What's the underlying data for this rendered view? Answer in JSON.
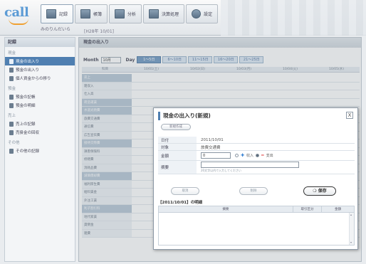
{
  "app": {
    "logo_text": "call",
    "user_name": "みのりんだいら",
    "date_line": "[H28年 10/01]"
  },
  "nav": [
    {
      "label": "記録",
      "icon": "notebook-icon"
    },
    {
      "label": "帳簿",
      "icon": "ledger-icon"
    },
    {
      "label": "分析",
      "icon": "chart-icon"
    },
    {
      "label": "決算処理",
      "icon": "calculator-icon"
    },
    {
      "label": "設定",
      "icon": "gear-icon"
    }
  ],
  "sidebar": {
    "title": "記録",
    "section1": "現金",
    "items1": [
      "現金の出入り",
      "預金の出入り",
      "個人資金からの移り"
    ],
    "section2": "預金",
    "items2": [
      "預金の記帳",
      "預金の明細"
    ],
    "section3": "売上",
    "items3": [
      "売上の記録",
      "売掛金の回収"
    ],
    "section4": "その他",
    "items4": [
      "その他の記録"
    ]
  },
  "main": {
    "title": "現金の出入り",
    "month_label": "Month",
    "month_value": "10月",
    "day_label": "Day",
    "day_tabs": [
      "1〜5日",
      "6〜10日",
      "11〜15日",
      "16〜20日",
      "21〜25日"
    ],
    "columns": [
      "科目",
      "10/01(土)",
      "10/02(日)",
      "10/03(月)",
      "10/04(火)",
      "10/05(水)"
    ],
    "rows": [
      "売上",
      "雑収入",
      "仕入高",
      "荷造運賃",
      "水道光熱費",
      "旅費交通費",
      "通信費",
      "広告宣伝費",
      "接待交際費",
      "損害保険料",
      "修繕費",
      "消耗品費",
      "減価償却費",
      "福利厚生費",
      "給料賃金",
      "外注工賃",
      "利子割引料",
      "地代家賃",
      "貸倒金",
      "雑費"
    ]
  },
  "dialog": {
    "title": "現金の出入り(新規)",
    "close_label": "X",
    "new_button": "新規作成",
    "fields": {
      "date_label": "日付",
      "date_value": "2011/10/01",
      "target_label": "対象",
      "target_value": "旅費交通費",
      "amount_label": "金額",
      "amount_value": "0",
      "radio_in_label": "収入",
      "radio_out_label": "支出",
      "memo_label": "摘要",
      "memo_hint": "20文字以内で入力してください"
    },
    "buttons": {
      "cancel": "取消",
      "delete": "削除",
      "save": "保存"
    },
    "details_title": "【2011/10/01】の明細",
    "details_columns": [
      "摘要",
      "取引区分",
      "金額"
    ]
  }
}
